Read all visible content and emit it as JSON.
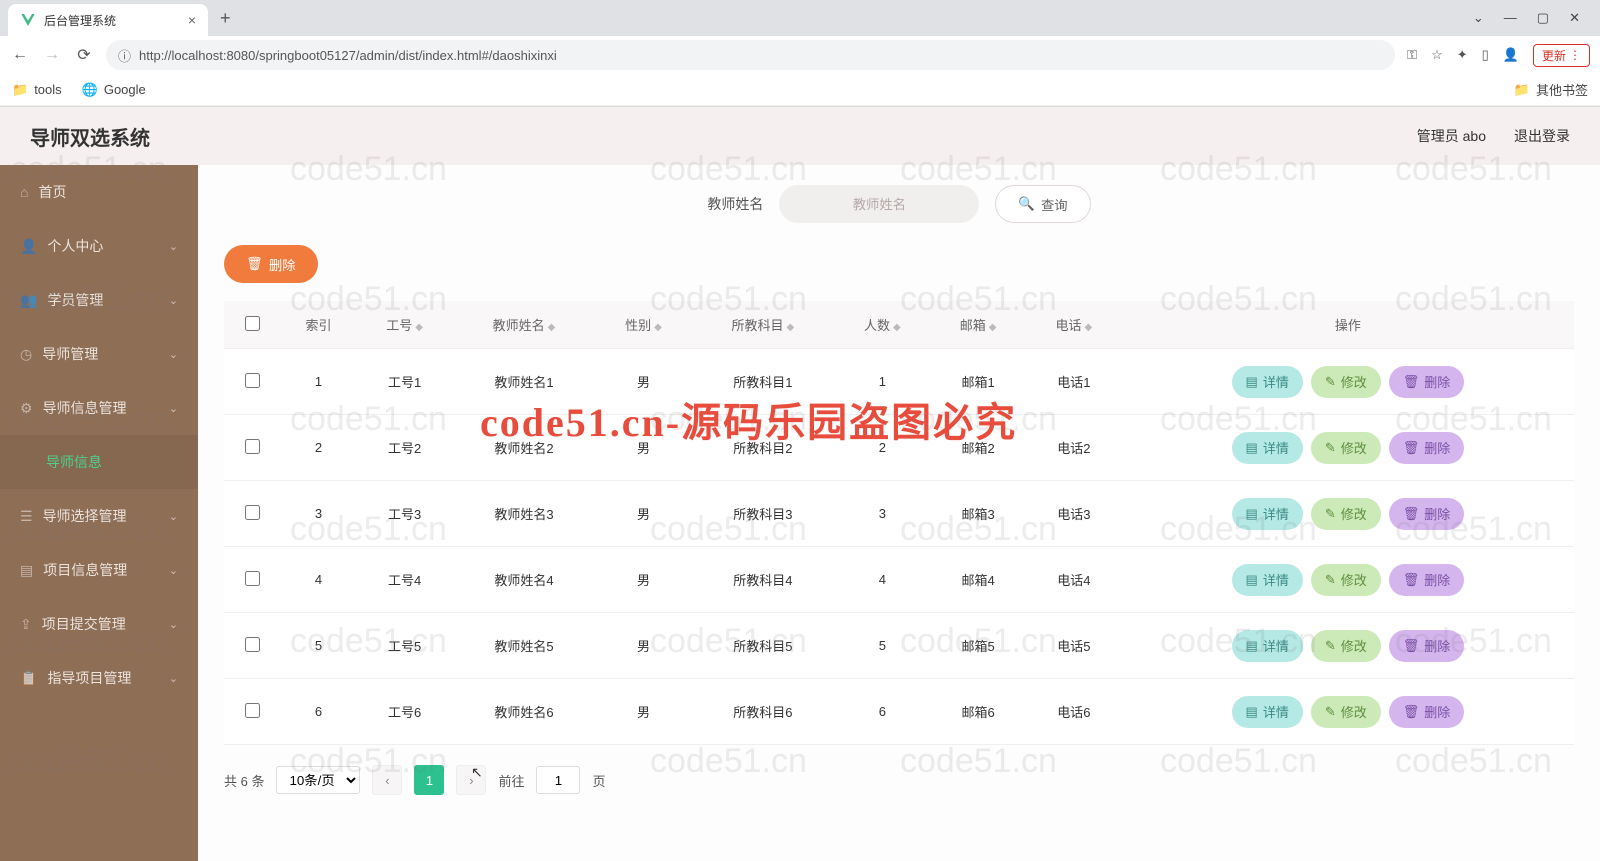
{
  "browser": {
    "tab_title": "后台管理系统",
    "url": "http://localhost:8080/springboot05127/admin/dist/index.html#/daoshixinxi",
    "update_label": "更新",
    "bookmarks": {
      "tools": "tools",
      "google": "Google",
      "other": "其他书签"
    }
  },
  "header": {
    "title": "导师双选系统",
    "user": "管理员 abo",
    "logout": "退出登录"
  },
  "sidebar": {
    "items": [
      {
        "label": "首页",
        "icon": "home"
      },
      {
        "label": "个人中心",
        "icon": "user",
        "expandable": true
      },
      {
        "label": "学员管理",
        "icon": "users",
        "expandable": true
      },
      {
        "label": "导师管理",
        "icon": "clock",
        "expandable": true
      },
      {
        "label": "导师信息管理",
        "icon": "gear",
        "expandable": true
      },
      {
        "label": "导师信息",
        "active": true
      },
      {
        "label": "导师选择管理",
        "icon": "list",
        "expandable": true
      },
      {
        "label": "项目信息管理",
        "icon": "bars",
        "expandable": true
      },
      {
        "label": "项目提交管理",
        "icon": "upload",
        "expandable": true
      },
      {
        "label": "指导项目管理",
        "icon": "clipboard",
        "expandable": true
      }
    ]
  },
  "search": {
    "label": "教师姓名",
    "placeholder": "教师姓名",
    "query": "查询"
  },
  "buttons": {
    "delete": "删除",
    "detail": "详情",
    "edit": "修改",
    "row_delete": "删除"
  },
  "table": {
    "headers": [
      "索引",
      "工号",
      "教师姓名",
      "性别",
      "所教科目",
      "人数",
      "邮箱",
      "电话",
      "操作"
    ],
    "rows": [
      {
        "idx": "1",
        "job": "工号1",
        "name": "教师姓名1",
        "gender": "男",
        "subject": "所教科目1",
        "count": "1",
        "email": "邮箱1",
        "phone": "电话1"
      },
      {
        "idx": "2",
        "job": "工号2",
        "name": "教师姓名2",
        "gender": "男",
        "subject": "所教科目2",
        "count": "2",
        "email": "邮箱2",
        "phone": "电话2"
      },
      {
        "idx": "3",
        "job": "工号3",
        "name": "教师姓名3",
        "gender": "男",
        "subject": "所教科目3",
        "count": "3",
        "email": "邮箱3",
        "phone": "电话3"
      },
      {
        "idx": "4",
        "job": "工号4",
        "name": "教师姓名4",
        "gender": "男",
        "subject": "所教科目4",
        "count": "4",
        "email": "邮箱4",
        "phone": "电话4"
      },
      {
        "idx": "5",
        "job": "工号5",
        "name": "教师姓名5",
        "gender": "男",
        "subject": "所教科目5",
        "count": "5",
        "email": "邮箱5",
        "phone": "电话5"
      },
      {
        "idx": "6",
        "job": "工号6",
        "name": "教师姓名6",
        "gender": "男",
        "subject": "所教科目6",
        "count": "6",
        "email": "邮箱6",
        "phone": "电话6"
      }
    ]
  },
  "pagination": {
    "total": "共 6 条",
    "page_size": "10条/页",
    "current": "1",
    "goto_prefix": "前往",
    "goto_value": "1",
    "goto_suffix": "页"
  },
  "watermark": {
    "text": "code51.cn",
    "red": "code51.cn-源码乐园盗图必究"
  }
}
